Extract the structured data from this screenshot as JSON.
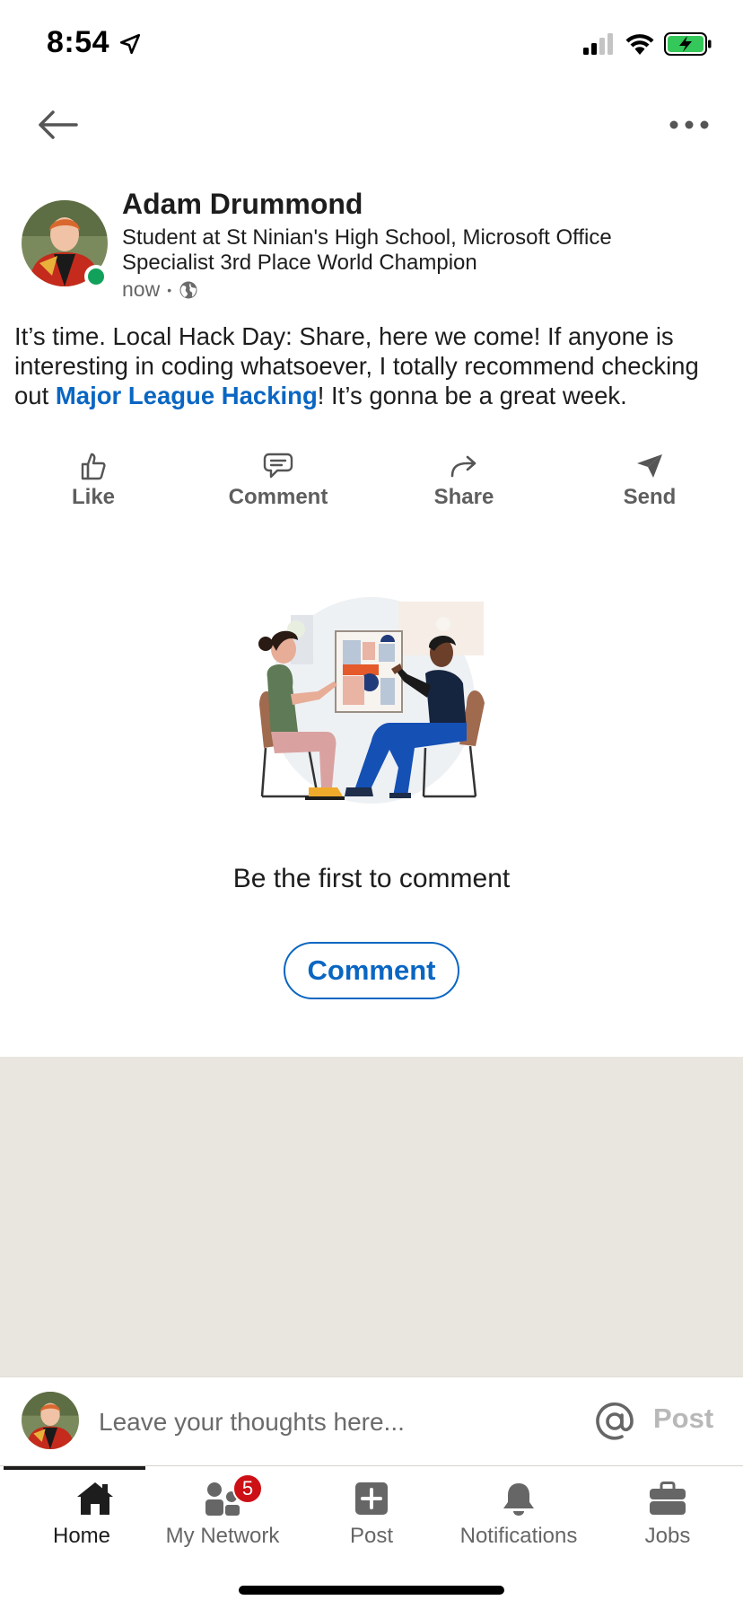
{
  "status_bar": {
    "time": "8:54"
  },
  "post": {
    "author": {
      "name": "Adam Drummond",
      "headline": "Student at St Ninian's High School, Microsoft Office Specialist 3rd Place World Champion",
      "time": "now",
      "separator": "•"
    },
    "body_before_link": "It’s time. Local Hack Day: Share, here we come! If anyone is interesting in coding whatsoever, I totally recommend checking out ",
    "link_text": "Major League Hacking",
    "body_after_link": "! It’s gonna be a great week."
  },
  "actions": [
    {
      "label": "Like",
      "icon": "thumbs-up-icon"
    },
    {
      "label": "Comment",
      "icon": "comment-bubble-icon"
    },
    {
      "label": "Share",
      "icon": "share-arrow-icon"
    },
    {
      "label": "Send",
      "icon": "paper-plane-icon"
    }
  ],
  "comments_empty": {
    "message": "Be the first to comment",
    "button_label": "Comment"
  },
  "composer": {
    "placeholder": "Leave your thoughts here...",
    "post_label": "Post"
  },
  "tabs": [
    {
      "label": "Home",
      "icon": "home-icon",
      "active": true
    },
    {
      "label": "My Network",
      "icon": "network-icon",
      "badge": "5"
    },
    {
      "label": "Post",
      "icon": "plus-square-icon"
    },
    {
      "label": "Notifications",
      "icon": "bell-icon"
    },
    {
      "label": "Jobs",
      "icon": "briefcase-icon"
    }
  ],
  "colors": {
    "link": "#0a66c2",
    "online": "#12a15a",
    "badge": "#cc1016",
    "gray_area": "#e9e5df",
    "battery": "#34c759"
  }
}
